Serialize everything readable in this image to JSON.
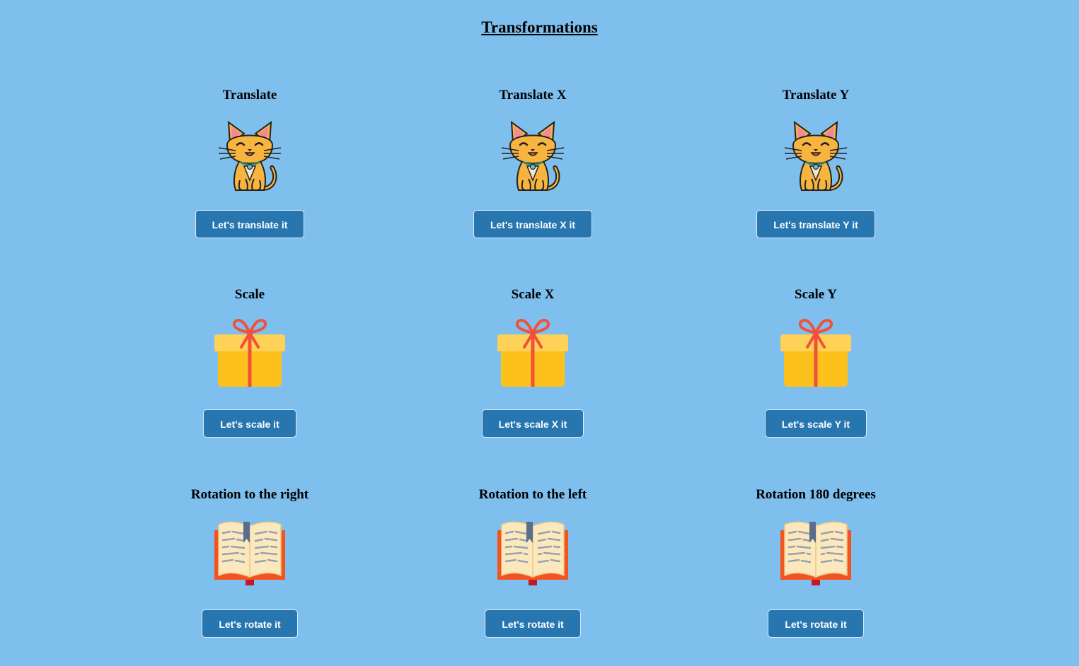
{
  "page": {
    "title": "Transformations",
    "background": "#7fbfed",
    "button_color": "#2776b0"
  },
  "rows": [
    {
      "illustration": "cat-icon",
      "cards": [
        {
          "title": "Translate",
          "button": "Let's translate it"
        },
        {
          "title": "Translate X",
          "button": "Let's translate X it"
        },
        {
          "title": "Translate Y",
          "button": "Let's translate Y it"
        }
      ]
    },
    {
      "illustration": "gift-icon",
      "cards": [
        {
          "title": "Scale",
          "button": "Let's scale it"
        },
        {
          "title": "Scale X",
          "button": "Let's scale X it"
        },
        {
          "title": "Scale Y",
          "button": "Let's scale Y it"
        }
      ]
    },
    {
      "illustration": "book-icon",
      "cards": [
        {
          "title": "Rotation to the right",
          "button": "Let's rotate it"
        },
        {
          "title": "Rotation to the left",
          "button": "Let's rotate it"
        },
        {
          "title": "Rotation 180 degrees",
          "button": "Let's rotate it"
        }
      ]
    }
  ]
}
